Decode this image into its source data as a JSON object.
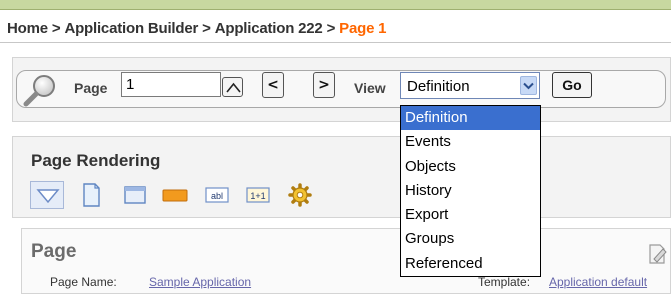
{
  "breadcrumb": {
    "items": [
      "Home",
      "Application Builder",
      "Application 222"
    ],
    "separator": ">",
    "current": "Page 1"
  },
  "nav": {
    "page_label": "Page",
    "page_value": "1",
    "prev_label": "<",
    "next_label": ">",
    "view_label": "View",
    "view_selected": "Definition",
    "go_label": "Go"
  },
  "view_menu": {
    "options": [
      "Definition",
      "Events",
      "Objects",
      "History",
      "Export",
      "Groups",
      "Referenced"
    ],
    "highlighted": "Definition"
  },
  "page_rendering": {
    "title": "Page Rendering",
    "tools": [
      "triangle-down-icon",
      "page-icon",
      "region-icon",
      "button-icon",
      "text-item-icon",
      "computation-icon",
      "process-gear-icon"
    ],
    "tool_texts": {
      "text_item": "abl",
      "computation": "1+1"
    }
  },
  "page_section": {
    "title": "Page",
    "page_name_label": "Page Name:",
    "page_name_value": "Sample Application",
    "template_label": "Template:",
    "template_value": "Application default"
  },
  "colors": {
    "current_crumb": "#ff6600",
    "highlight": "#3a6fcf",
    "top_strip": "#c8d8a0"
  }
}
